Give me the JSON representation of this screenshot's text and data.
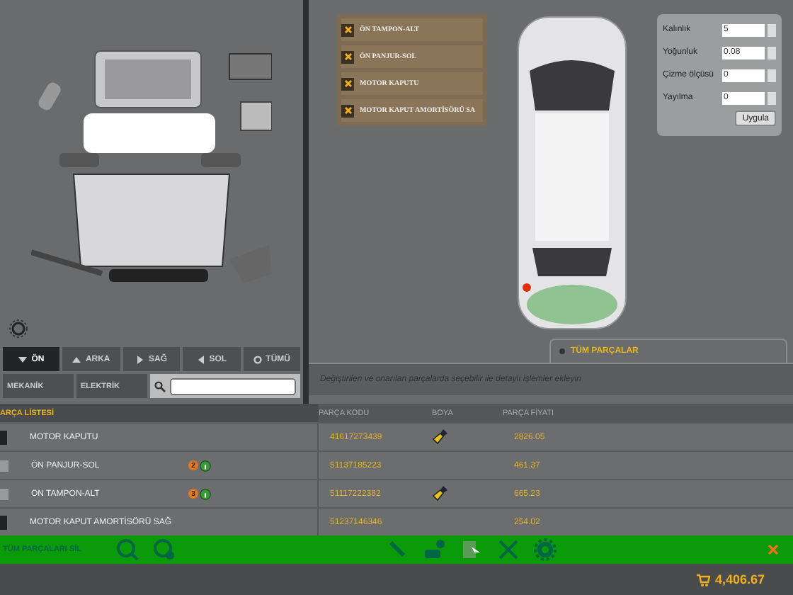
{
  "selected_parts": [
    {
      "label": "ÖN TAMPON-ALT"
    },
    {
      "label": "ÖN PANJUR-SOL"
    },
    {
      "label": "MOTOR KAPUTU"
    },
    {
      "label": "MOTOR KAPUT AMORTİSÖRÜ SA"
    }
  ],
  "paint_settings": [
    {
      "label": "Kalınlık",
      "value": "5"
    },
    {
      "label": "Yoğunluk",
      "value": "0.08"
    },
    {
      "label": "Çizme ölçüsü",
      "value": "0"
    },
    {
      "label": "Yayılma",
      "value": "0"
    }
  ],
  "apply_button": "Uygula",
  "view_buttons": [
    {
      "label": "ÖN",
      "selected": true
    },
    {
      "label": "ARKA",
      "selected": false
    },
    {
      "label": "SAĞ",
      "selected": false
    },
    {
      "label": "SOL",
      "selected": false
    },
    {
      "label": "TÜMÜ",
      "selected": false
    }
  ],
  "category_buttons": [
    {
      "label": "MEKANİK"
    },
    {
      "label": "ELEKTRİK"
    }
  ],
  "tab": {
    "label": "TÜM PARÇALAR"
  },
  "hint": "Değiştirilen ve onarılan parçalarda seçebilir ile detaylı işlemler ekleyin",
  "table": {
    "title": "ARÇA LİSTESİ",
    "columns": [
      "PARÇA KODU",
      "BOYA",
      "PARÇA FİYATI"
    ],
    "rows": [
      {
        "kind": "plain",
        "name": "MOTOR KAPUTU",
        "count": null,
        "code": "41617273439",
        "paint": true,
        "price": "2826.05"
      },
      {
        "kind": "edit",
        "name": "ÖN PANJUR-SOL",
        "count": "2",
        "code": "51137185223",
        "paint": false,
        "price": "461.37"
      },
      {
        "kind": "edit",
        "name": "ÖN TAMPON-ALT",
        "count": "3",
        "code": "51117222382",
        "paint": true,
        "price": "665.23"
      },
      {
        "kind": "plain",
        "name": "MOTOR KAPUT AMORTİSÖRÜ SAĞ",
        "count": null,
        "code": "51237146346",
        "paint": false,
        "price": "254.02"
      }
    ]
  },
  "action_bar": {
    "delete_all": "TÜM PARÇALARI SİL"
  },
  "total": "4,406.67"
}
